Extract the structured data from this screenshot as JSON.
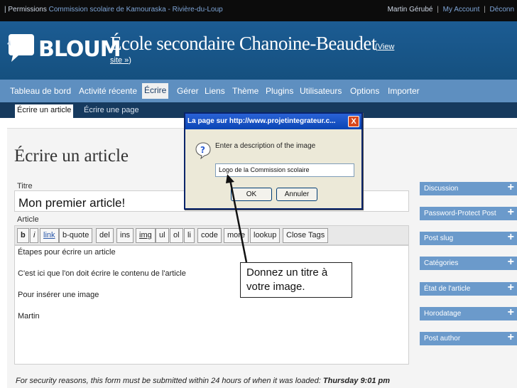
{
  "topbar": {
    "permissions": "Permissions",
    "school_board": "Commission scolaire de Kamouraska - Rivière-du-Loup",
    "user": "Martin Gérubé",
    "my_account": "My Account",
    "logout": "Déconn"
  },
  "header": {
    "logo_text": "BLOUM",
    "site_title": "École secondaire Chanoine-Beaudet",
    "view_site_1": "View",
    "view_site_2": "site »"
  },
  "menu": {
    "items": [
      "Tableau de bord",
      "Activité récente",
      "Écrire",
      "Gérer",
      "Liens",
      "Thème",
      "Plugins",
      "Utilisateurs",
      "Options",
      "Importer"
    ]
  },
  "submenu": {
    "items": [
      "Écrire un article",
      "Écrire une page"
    ]
  },
  "editor": {
    "page_title": "Écrire un article",
    "title_label": "Titre",
    "title_value": "Mon premier article!",
    "article_label": "Article",
    "toolbar": [
      "b",
      "i",
      "link",
      "b-quote",
      "del",
      "ins",
      "img",
      "ul",
      "ol",
      "li",
      "code",
      "more",
      "lookup",
      "Close Tags"
    ],
    "content_lines": [
      "Étapes pour écrire un article",
      "C'est ici que l'on doit écrire le contenu de l'article",
      "Pour insérer une image",
      "Martin"
    ]
  },
  "notice": {
    "text": "For security reasons, this form must be submitted within 24 hours of when it was loaded: ",
    "time": "Thursday 9:01 pm"
  },
  "sidebar": {
    "boxes": [
      "Discussion",
      "Password-Protect Post",
      "Post slug",
      "Catégories",
      "État de l'article",
      "Horodatage",
      "Post author"
    ],
    "plus": "+"
  },
  "dialog": {
    "title": "La page sur http://www.projetintegrateur.c...",
    "close": "X",
    "prompt": "Enter a description of the image",
    "input_value": "Logo de la Commission scolaire",
    "ok": "OK",
    "cancel": "Annuler"
  },
  "callout": {
    "text": "Donnez un titre à votre image."
  },
  "colors": {
    "header_blue": "#1c5c93",
    "menu_blue": "#5e8fc0",
    "submenu_navy": "#163a5e",
    "sidebox_blue": "#6b9acb"
  }
}
